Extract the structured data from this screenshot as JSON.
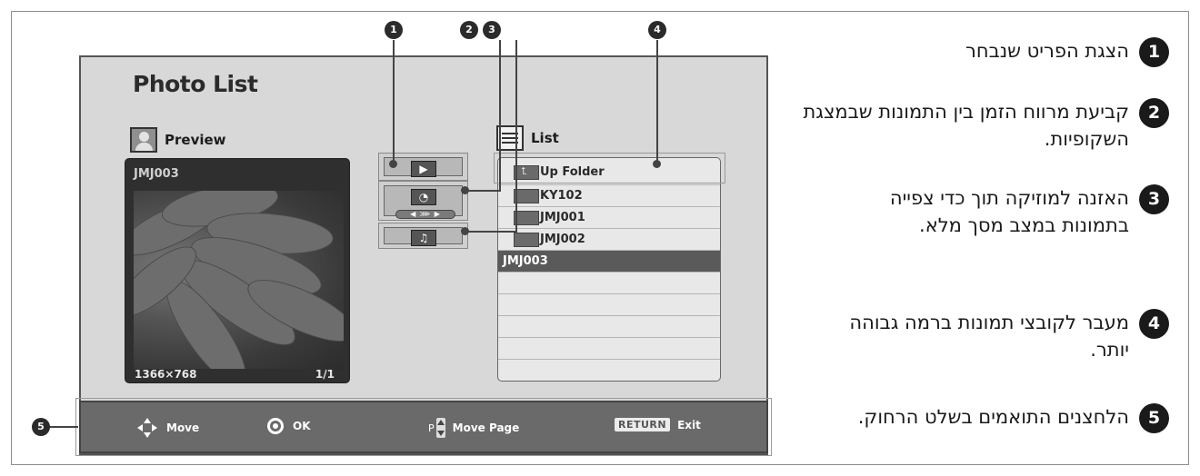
{
  "screen": {
    "title": "Photo List",
    "preview": {
      "label": "Preview",
      "file_name": "JMJ003",
      "resolution": "1366×768",
      "page": "1/1",
      "icon": "person-picture-icon"
    },
    "options": {
      "items": [
        {
          "name": "view-selected",
          "icon": "play-icon"
        },
        {
          "name": "slideshow-interval",
          "icon": "clock-icon",
          "speed_glyph": "◀ ⋙ ▶"
        },
        {
          "name": "background-music",
          "icon": "music-icon"
        }
      ]
    },
    "list": {
      "label": "List",
      "icon": "list-icon",
      "items": [
        {
          "label": "Up Folder",
          "icon": "up-folder-icon"
        },
        {
          "label": "KY102",
          "icon": "folder-icon"
        },
        {
          "label": "JMJ001",
          "icon": "folder-icon"
        },
        {
          "label": "JMJ002",
          "icon": "folder-icon"
        },
        {
          "label": "JMJ003",
          "selected": true
        }
      ]
    },
    "bottom_bar": {
      "move": "Move",
      "ok": "OK",
      "page_key": "P",
      "move_page": "Move Page",
      "return_key": "RETURN",
      "exit": "Exit"
    }
  },
  "callouts": [
    "1",
    "2",
    "3",
    "4",
    "5"
  ],
  "descriptions": [
    {
      "number": "1",
      "text": "הצגת הפריט שנבחר"
    },
    {
      "number": "2",
      "text": "קביעת מרווח הזמן בין התמונות שבמצגת השקופיות."
    },
    {
      "number": "3",
      "text": "האזנה למוזיקה תוך כדי צפייה בתמונות במצב מסך מלא."
    },
    {
      "number": "4",
      "text": "מעבר לקובצי תמונות ברמה גבוהה יותר."
    },
    {
      "number": "5",
      "text": "הלחצנים התואמים בשלט הרחוק."
    }
  ]
}
